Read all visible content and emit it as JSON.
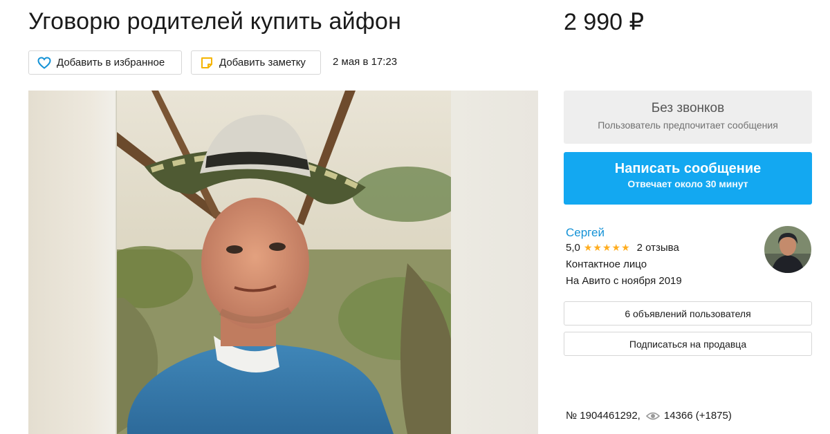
{
  "listing": {
    "title": "Уговорю родителей купить айфон",
    "price": "2 990 ₽",
    "favorite_label": "Добавить в избранное",
    "note_label": "Добавить заметку",
    "date": "2 мая в 17:23"
  },
  "contact": {
    "no_calls_title": "Без звонков",
    "no_calls_subtitle": "Пользователь предпочитает сообщения",
    "message_button_title": "Написать сообщение",
    "message_button_subtitle": "Отвечает около 30 минут"
  },
  "seller": {
    "name": "Сергей",
    "rating": "5,0",
    "stars": "★★★★★",
    "reviews": "2 отзыва",
    "role": "Контактное лицо",
    "since": "На Авито с ноября 2019",
    "listings_button": "6 объявлений пользователя",
    "subscribe_button": "Подписаться на продавца"
  },
  "footer": {
    "ad_number": "№ 1904461292,",
    "views": "14366 (+1875)"
  },
  "icons": {
    "favorite": "heart-icon",
    "note": "note-icon",
    "views": "eye-icon"
  },
  "colors": {
    "accent_blue": "#13a8f1",
    "link_blue": "#1492d6",
    "star_orange": "#ffad1f",
    "heart_blue": "#1492d6",
    "note_yellow": "#f5b400"
  }
}
